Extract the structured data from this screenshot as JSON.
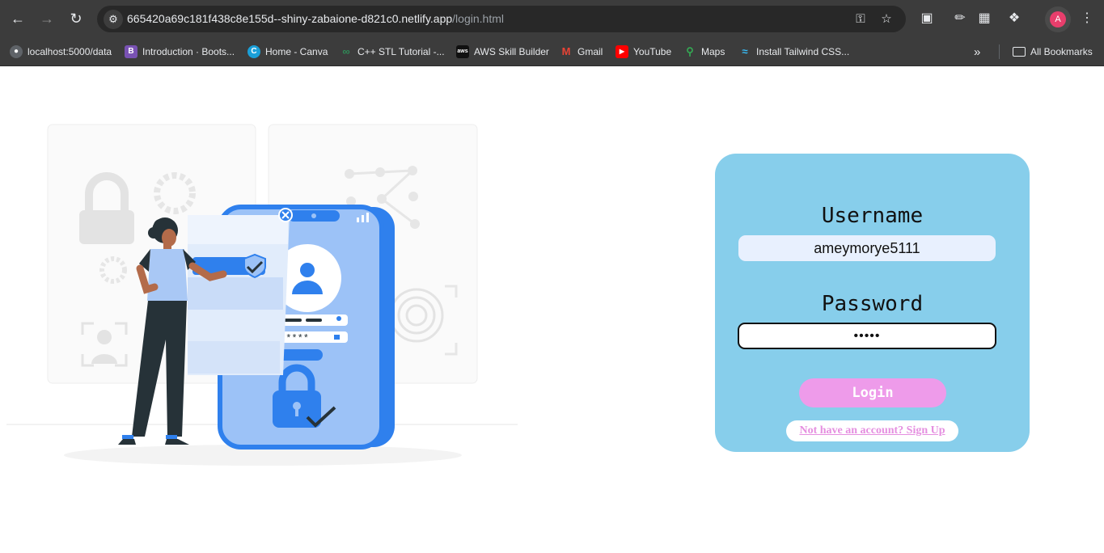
{
  "browser": {
    "url_host": "665420a69c181f438c8e155d--shiny-zabaione-d821c0.netlify.app",
    "url_path": "/login.html",
    "profile_initial": "A",
    "bookmarks": [
      {
        "label": "localhost:5000/data",
        "icon": "globe-icon",
        "color": "#5f6368"
      },
      {
        "label": "Introduction · Boots...",
        "icon": "bootstrap-icon",
        "color": "#7952b3"
      },
      {
        "label": "Home - Canva",
        "icon": "canva-icon",
        "color": "#1a9fd8"
      },
      {
        "label": "C++ STL Tutorial -...",
        "icon": "infinity-icon",
        "color": "#2f8b57"
      },
      {
        "label": "AWS Skill Builder",
        "icon": "aws-icon",
        "color": "#111111"
      },
      {
        "label": "Gmail",
        "icon": "gmail-icon",
        "color": "#ea4335"
      },
      {
        "label": "YouTube",
        "icon": "youtube-icon",
        "color": "#ff0000"
      },
      {
        "label": "Maps",
        "icon": "maps-icon",
        "color": "#34a853"
      },
      {
        "label": "Install Tailwind CSS...",
        "icon": "tailwind-icon",
        "color": "#38bdf8"
      }
    ],
    "all_bookmarks": "All Bookmarks"
  },
  "form": {
    "username_label": "Username",
    "username_value": "ameymorye5111",
    "password_label": "Password",
    "password_value": "•••••",
    "login_label": "Login",
    "signup_link": "Not have an account? Sign Up"
  },
  "colors": {
    "card": "#87ceeb",
    "button": "#ee9bea",
    "link": "#e58fe0",
    "illustration_blue": "#2f80ed"
  }
}
